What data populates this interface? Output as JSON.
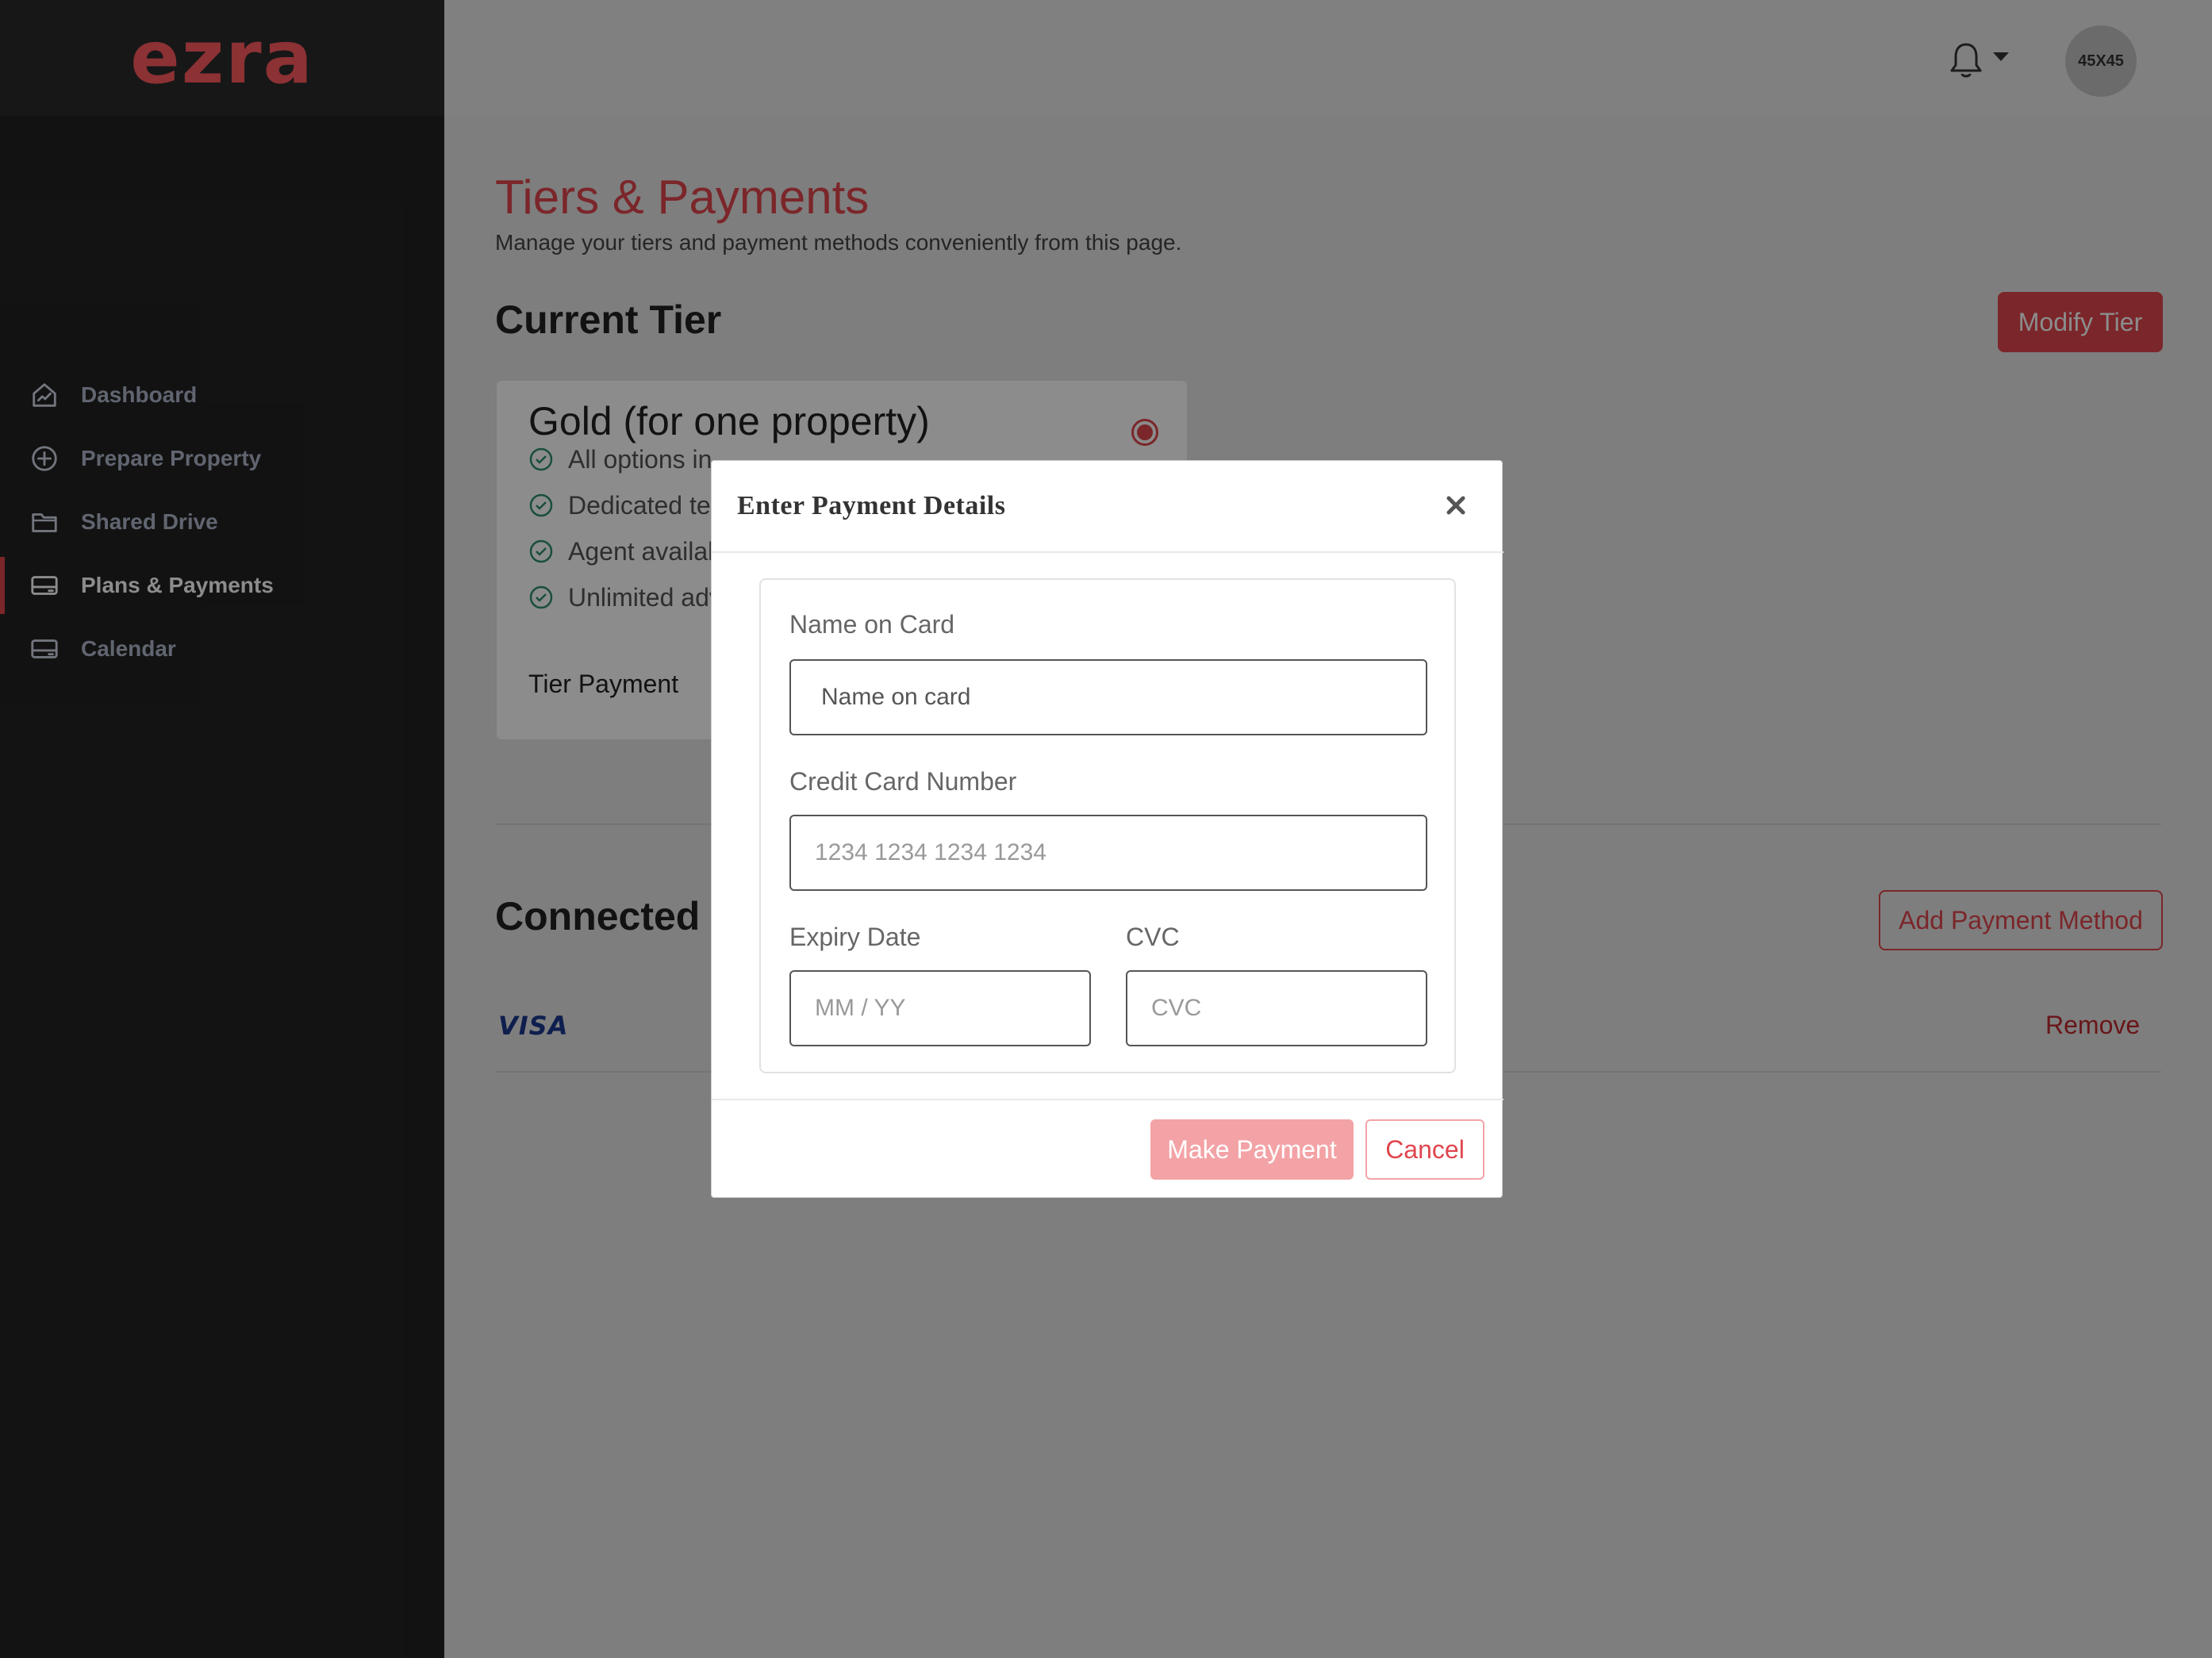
{
  "brand": {
    "logo": "ezra",
    "accent": "#e0464e",
    "logo_color": "#ff5a5f"
  },
  "sidebar": {
    "items": [
      {
        "label": "Dashboard",
        "icon": "chart-home-icon",
        "active": false
      },
      {
        "label": "Prepare Property",
        "icon": "plus-circle-icon",
        "active": false
      },
      {
        "label": "Shared Drive",
        "icon": "folder-icon",
        "active": false
      },
      {
        "label": "Plans & Payments",
        "icon": "card-icon",
        "active": true
      },
      {
        "label": "Calendar",
        "icon": "card-icon",
        "active": false
      }
    ]
  },
  "topbar": {
    "notifications_icon": "bell-icon",
    "avatar_label": "45X45"
  },
  "page": {
    "title": "Tiers & Payments",
    "subtitle": "Manage your tiers and payment methods conveniently from this page."
  },
  "current_tier": {
    "heading": "Current Tier",
    "modify_label": "Modify Tier",
    "tier_name": "Gold (for one property)",
    "features": [
      "All options in",
      "Dedicated te",
      "Agent availab",
      "Unlimited adv"
    ],
    "payment_label": "Tier Payment"
  },
  "connected": {
    "heading": "Connected P",
    "add_label": "Add Payment Method",
    "card_brand": "VISA",
    "remove_label": "Remove"
  },
  "modal": {
    "title": "Enter Payment Details",
    "name_label": "Name on Card",
    "name_value": "Name on card",
    "card_label": "Credit Card Number",
    "card_placeholder": "1234 1234 1234 1234",
    "expiry_label": "Expiry Date",
    "expiry_placeholder": "MM / YY",
    "cvc_label": "CVC",
    "cvc_placeholder": "CVC",
    "pay_label": "Make Payment",
    "cancel_label": "Cancel"
  }
}
